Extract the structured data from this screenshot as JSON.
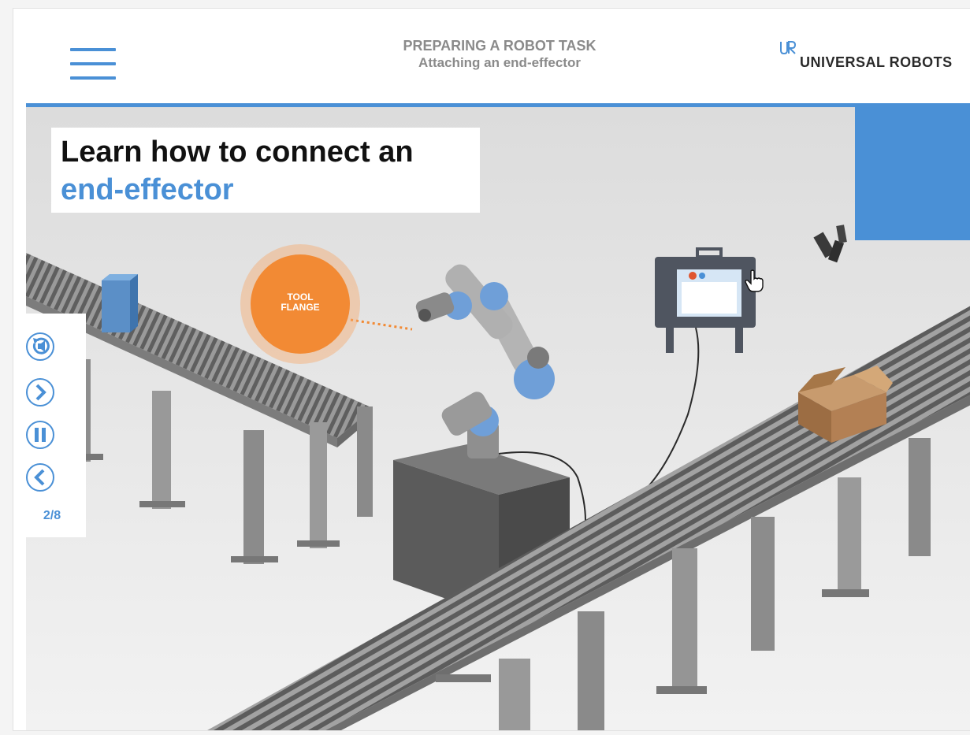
{
  "header": {
    "title": "PREPARING A ROBOT TASK",
    "subtitle": "Attaching an end-effector",
    "logo_text": "UNIVERSAL ROBOTS",
    "menu_icon": "hamburger-menu-icon"
  },
  "scene": {
    "heading_line1": "Learn how to connect an",
    "heading_line2": "end-effector",
    "callout_line1": "TOOL",
    "callout_line2": "FLANGE"
  },
  "controls": {
    "replay_icon": "replay-audio-icon",
    "next_icon": "chevron-right-icon",
    "pause_icon": "pause-icon",
    "prev_icon": "chevron-left-icon",
    "counter": "2/8"
  },
  "colors": {
    "accent": "#4a90d6",
    "callout": "#f28a34",
    "heading_text": "#111111",
    "header_text": "#8a8a8a"
  }
}
